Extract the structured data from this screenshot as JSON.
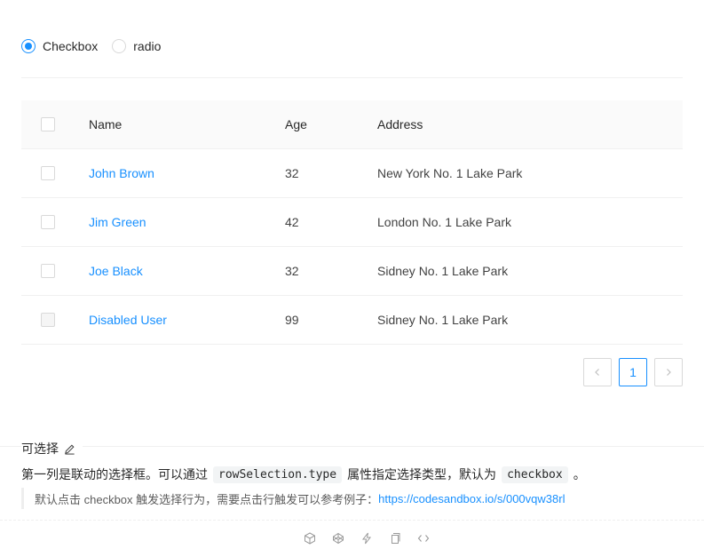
{
  "selection_type": {
    "options": [
      {
        "label": "Checkbox",
        "checked": true
      },
      {
        "label": "radio",
        "checked": false
      }
    ]
  },
  "table": {
    "columns": [
      "Name",
      "Age",
      "Address"
    ],
    "rows": [
      {
        "name": "John Brown",
        "age": "32",
        "address": "New York No. 1 Lake Park",
        "disabled": false
      },
      {
        "name": "Jim Green",
        "age": "42",
        "address": "London No. 1 Lake Park",
        "disabled": false
      },
      {
        "name": "Joe Black",
        "age": "32",
        "address": "Sidney No. 1 Lake Park",
        "disabled": false
      },
      {
        "name": "Disabled User",
        "age": "99",
        "address": "Sidney No. 1 Lake Park",
        "disabled": true
      }
    ]
  },
  "pagination": {
    "prev_icon": "chevron-left-icon",
    "current_page": "1",
    "next_icon": "chevron-right-icon"
  },
  "demo": {
    "title": "可选择",
    "edit_icon": "edit-icon",
    "desc_before": "第一列是联动的选择框。可以通过",
    "code1": "rowSelection.type",
    "desc_middle": "属性指定选择类型，默认为",
    "code2": "checkbox",
    "desc_after": "。",
    "note": "默认点击 checkbox 触发选择行为，需要点击行触发可以参考例子：",
    "link": "https://codesandbox.io/s/000vqw38rl"
  },
  "actions": [
    "codesandbox-icon",
    "codepen-icon",
    "thunderbolt-icon",
    "copy-icon",
    "code-icon"
  ],
  "colors": {
    "primary": "#1890ff",
    "border": "#d9d9d9",
    "header_bg": "#fafafa"
  }
}
